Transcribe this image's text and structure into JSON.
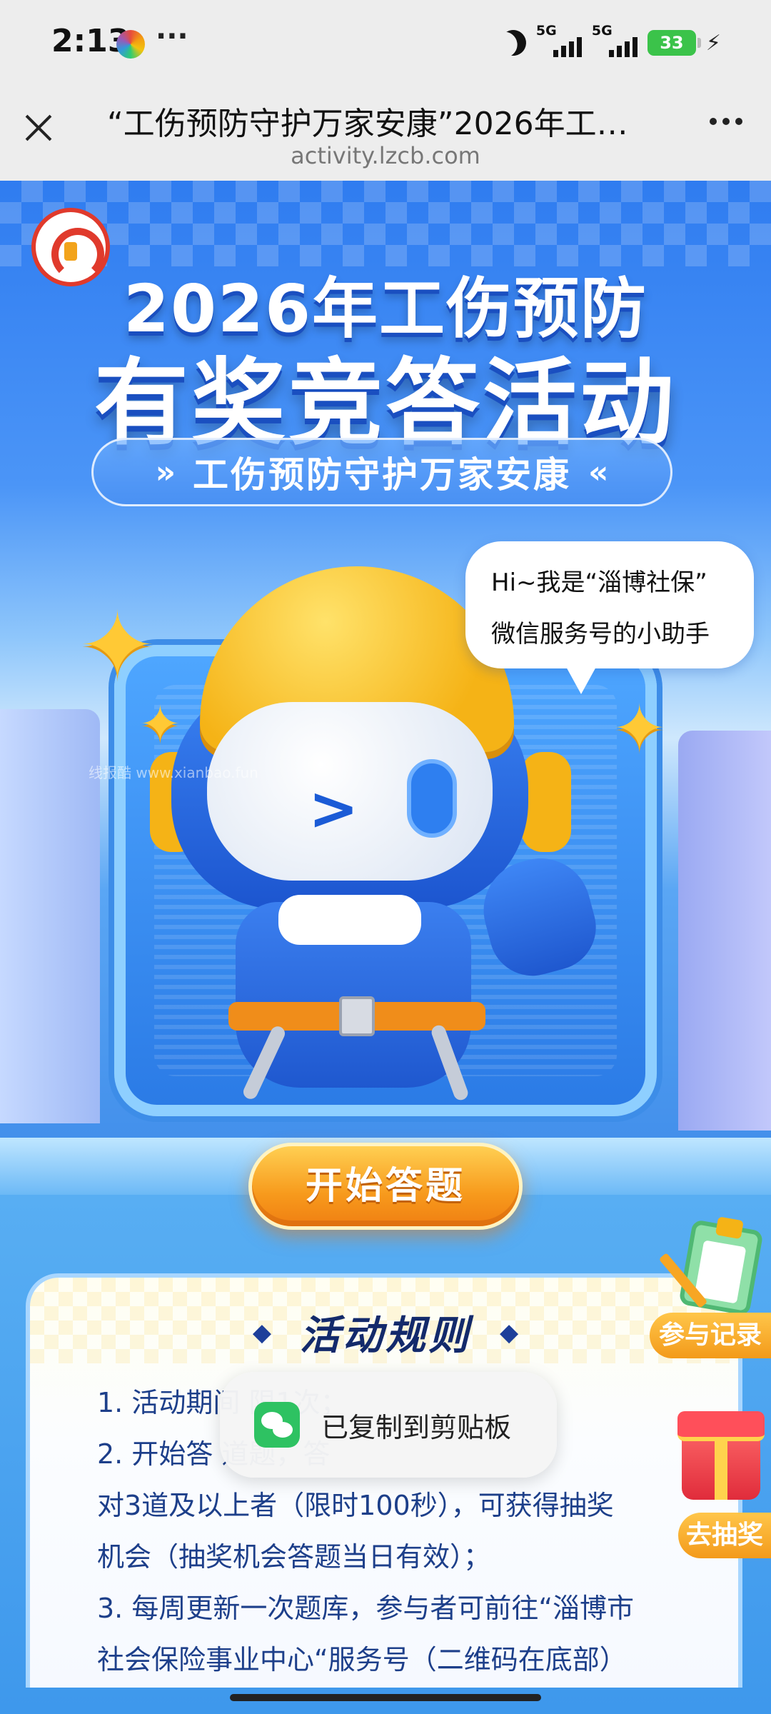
{
  "status_bar": {
    "time": "2:13",
    "more": "···",
    "network_1": "5G",
    "network_2": "5G",
    "battery": "33",
    "colors": {
      "battery": "#3bc34a"
    }
  },
  "browser": {
    "title": "“工伤预防守护万家安康”2026年工…",
    "domain": "activity.lzcb.com",
    "icons": {
      "close": "close-icon",
      "menu": "more-dots-icon"
    }
  },
  "hero": {
    "year_title": "2026年工伤预防",
    "main_title": "有奖竞答活动",
    "slogan": "工伤预防守护万家安康",
    "speech_line_1": "Hi~我是“淄博社保”",
    "speech_line_2": "微信服务号的小助手",
    "watermark": "线报酷 www.xianbao.fun",
    "start_button": "开始答题",
    "colors": {
      "primary_blue": "#2f7cf0",
      "button_orange": "#f79a1c"
    }
  },
  "rules": {
    "title": "活动规则",
    "lines": [
      "1. 活动期间                                              限1次；",
      "2. 开始答                                                道题，答",
      "对3道及以上者（限时100秒），可获得抽奖",
      "机会（抽奖机会答题当日有效）；",
      "3. 每周更新一次题库，参与者可前往“淄博市",
      "社会保险事业中心“服务号（二维码在底部）"
    ]
  },
  "side_buttons": {
    "record": "参与记录",
    "lottery": "去抽奖"
  },
  "toast": {
    "text": "已复制到剪贴板",
    "icon": "wechat-icon"
  }
}
